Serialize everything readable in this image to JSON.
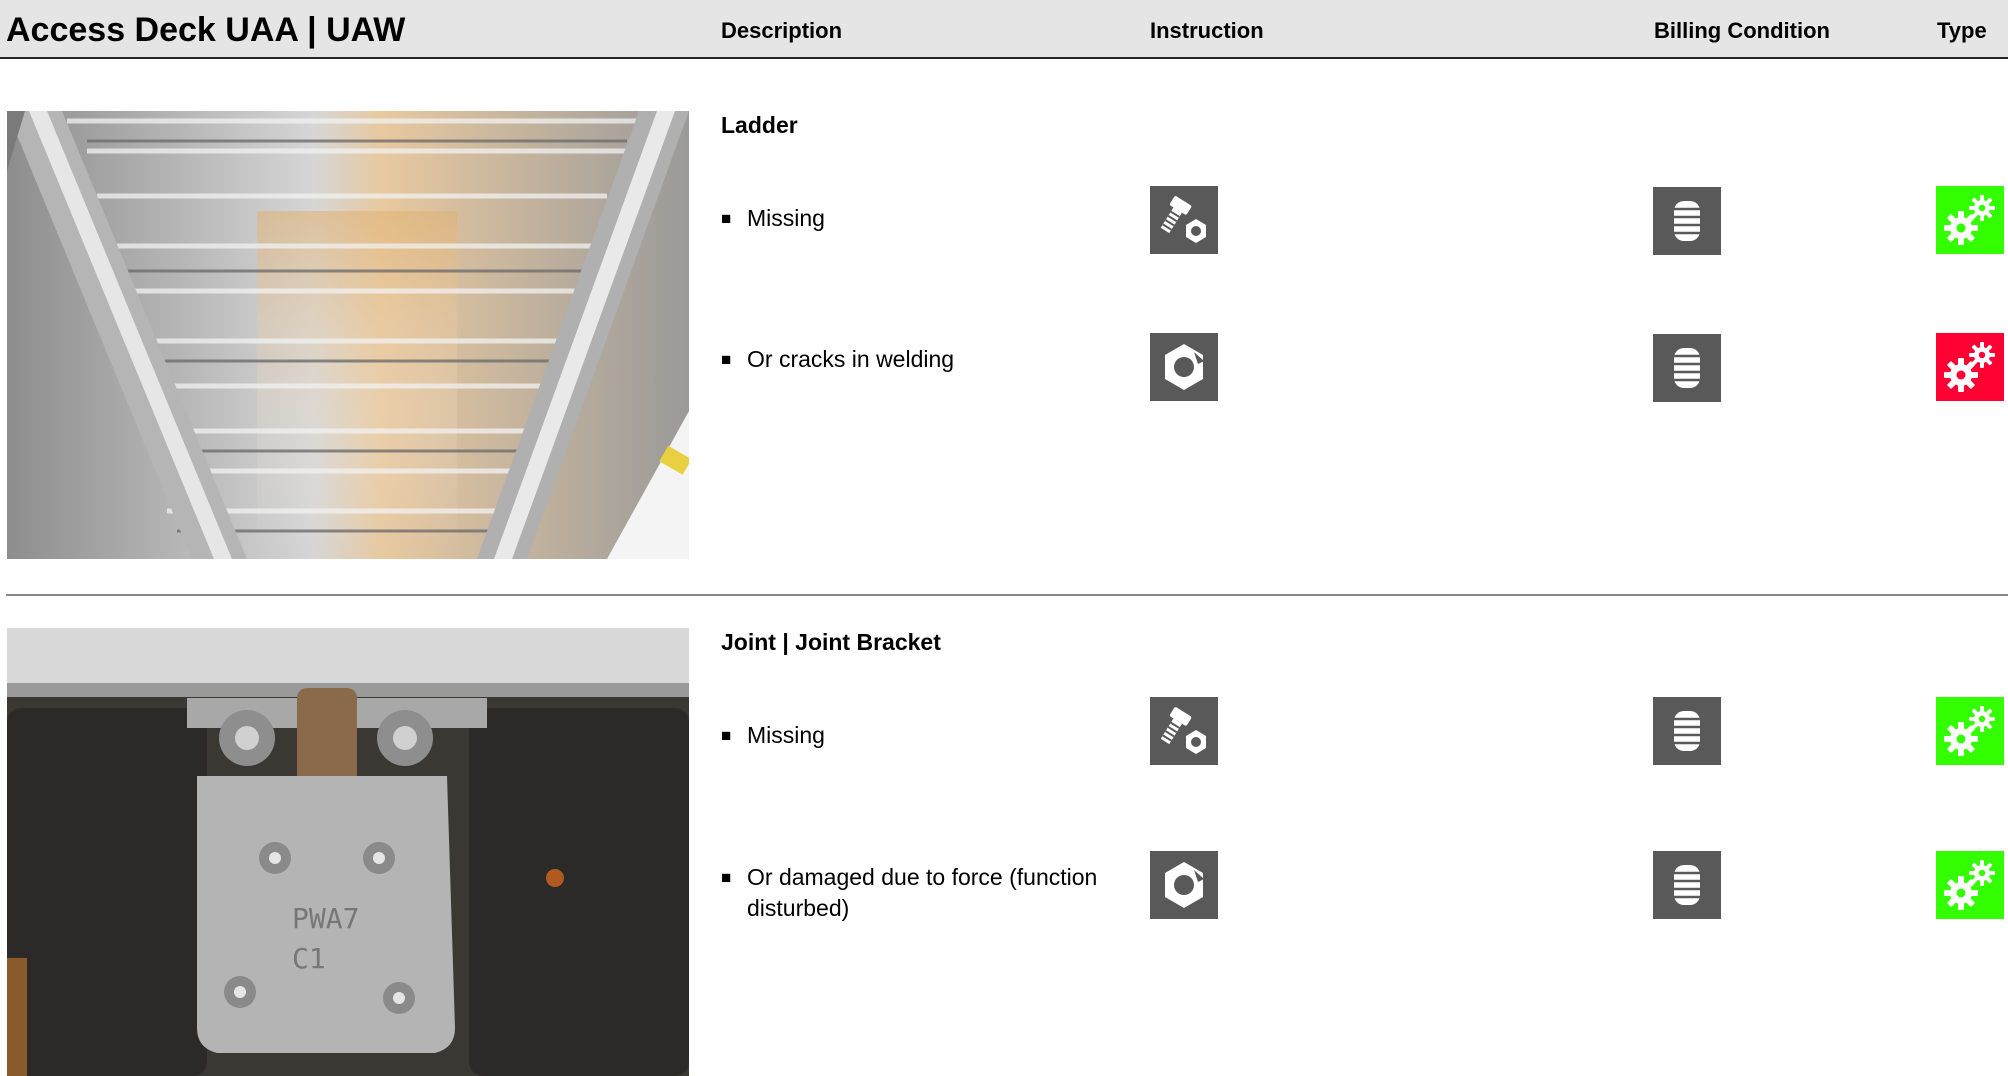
{
  "header": {
    "title": "Access Deck UAA | UAW",
    "col_description": "Description",
    "col_instruction": "Instruction",
    "col_billing": "Billing Condition",
    "col_type": "Type"
  },
  "sections": [
    {
      "title": "Ladder",
      "photo": "aluminium-ladder-deck-underside-photo",
      "items": [
        {
          "bullet": "■",
          "text": "Missing",
          "instruction_icon": "bolt-and-nut-icon",
          "billing_icon": "coin-stack-icon",
          "type_icon": "gears-icon",
          "type_color": "#33ff00"
        },
        {
          "bullet": "■",
          "text": "Or cracks in welding",
          "instruction_icon": "broken-nut-icon",
          "billing_icon": "coin-stack-icon",
          "type_icon": "gears-icon",
          "type_color": "#ff0033"
        }
      ]
    },
    {
      "title": "Joint | Joint Bracket",
      "photo": "joint-bracket-hinge-photo",
      "photo_text": "PWA7 C1",
      "items": [
        {
          "bullet": "■",
          "text": "Missing",
          "instruction_icon": "bolt-and-nut-icon",
          "billing_icon": "coin-stack-icon",
          "type_icon": "gears-icon",
          "type_color": "#33ff00"
        },
        {
          "bullet": "■",
          "text": "Or damaged due to force (function disturbed)",
          "instruction_icon": "broken-nut-icon",
          "billing_icon": "coin-stack-icon",
          "type_icon": "gears-icon",
          "type_color": "#33ff00"
        }
      ]
    }
  ],
  "colors": {
    "icon_gray": "#595959",
    "header_bg": "#e5e5e5",
    "type_ok": "#33ff00",
    "type_alert": "#ff0033"
  }
}
